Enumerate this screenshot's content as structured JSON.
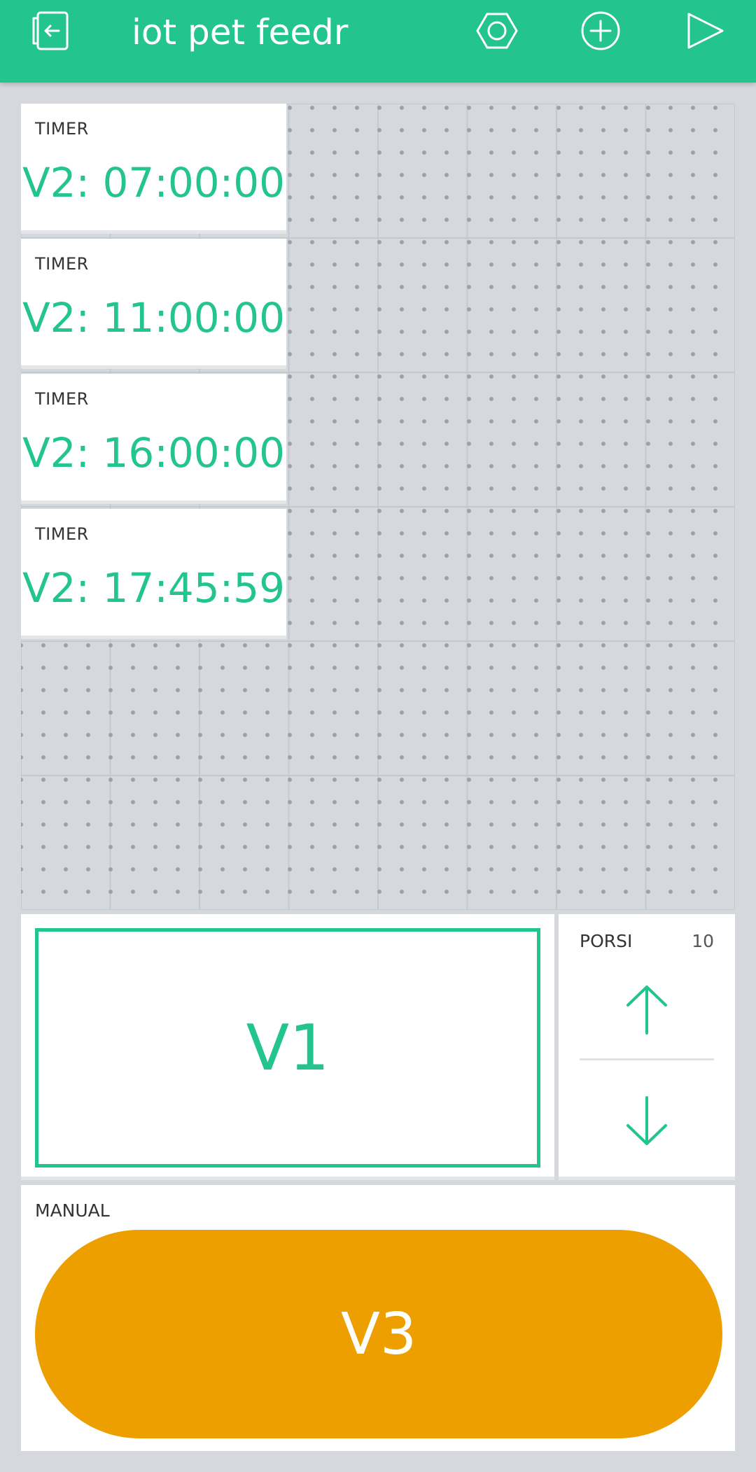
{
  "app": {
    "title": "iot pet feedr",
    "accent_color": "#23c48e",
    "icons": [
      "exit-icon",
      "nut-settings-icon",
      "add-icon",
      "play-icon"
    ]
  },
  "timers": [
    {
      "label": "TIMER",
      "value": "V2: 07:00:00"
    },
    {
      "label": "TIMER",
      "value": "V2: 11:00:00"
    },
    {
      "label": "TIMER",
      "value": "V2: 16:00:00"
    },
    {
      "label": "TIMER",
      "value": "V2: 17:45:59"
    }
  ],
  "display": {
    "value": "V1"
  },
  "stepper": {
    "label": "PORSI",
    "value": "10",
    "icons": [
      "arrow-up-icon",
      "arrow-down-icon"
    ]
  },
  "manual": {
    "label": "MANUAL",
    "button_label": "V3",
    "button_color": "#ee9f00"
  }
}
